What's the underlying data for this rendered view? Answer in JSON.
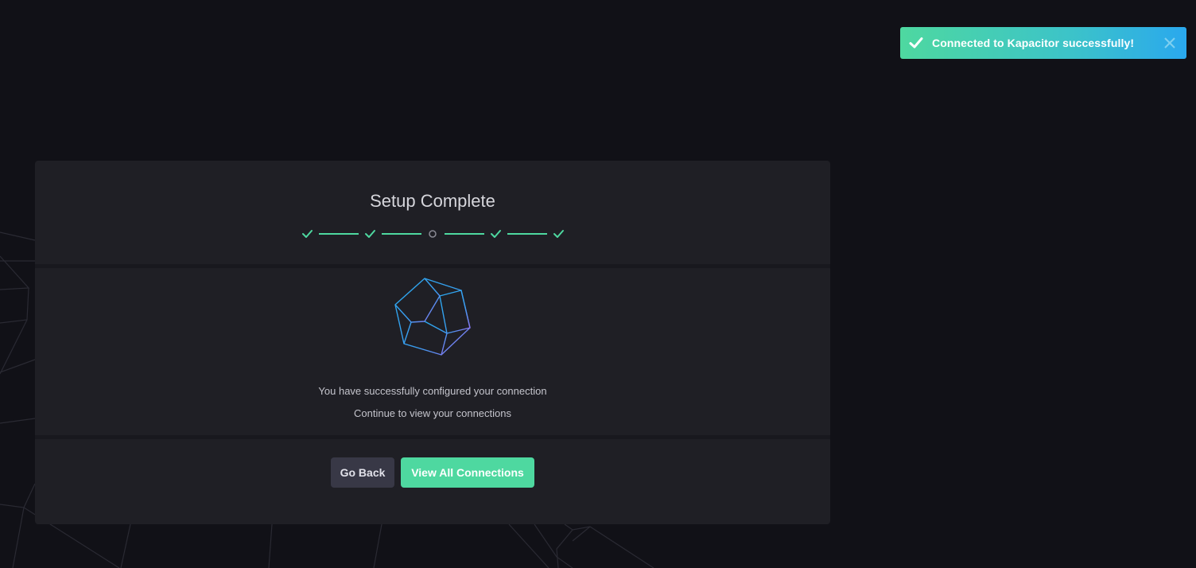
{
  "toast": {
    "message": "Connected to Kapacitor successfully!",
    "check_icon": "check-icon",
    "close_icon": "close-icon"
  },
  "wizard": {
    "title": "Setup Complete",
    "steps": [
      {
        "status": "complete"
      },
      {
        "status": "complete"
      },
      {
        "status": "skipped"
      },
      {
        "status": "complete"
      },
      {
        "status": "complete"
      }
    ],
    "illustration": "polyhedron-icon",
    "message_primary": "You have successfully configured your connection",
    "message_secondary": "Continue to view your connections",
    "buttons": {
      "back_label": "Go Back",
      "view_all_label": "View All Connections"
    }
  },
  "colors": {
    "background": "#111117",
    "panel": "#1f1f25",
    "accent_green": "#4ed8a0",
    "accent_blue": "#2aa8ee",
    "button_secondary": "#383846"
  }
}
